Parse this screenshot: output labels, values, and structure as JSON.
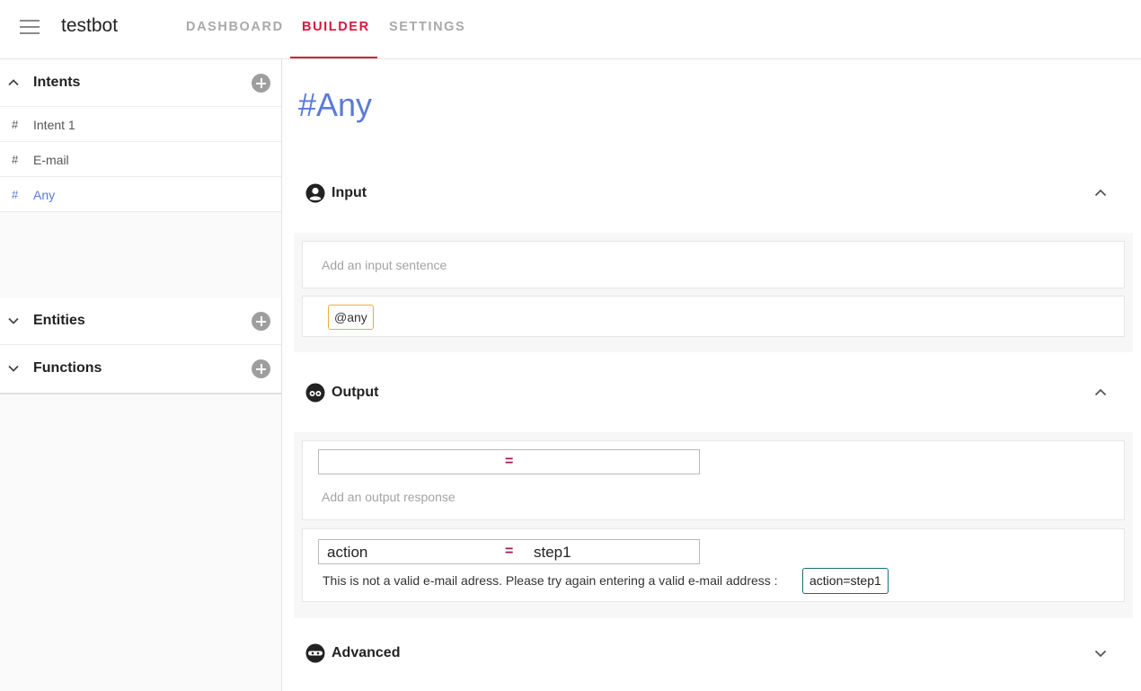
{
  "app": {
    "title": "testbot"
  },
  "tabs": [
    {
      "label": "DASHBOARD",
      "active": false
    },
    {
      "label": "BUILDER",
      "active": true
    },
    {
      "label": "SETTINGS",
      "active": false
    }
  ],
  "colors": {
    "accent": "#d6173d",
    "link": "#5a7bd5",
    "chip_any_border": "#e8b23a",
    "chip_action_border": "#1e6b7a"
  },
  "sidebar": {
    "intents": {
      "title": "Intents",
      "expanded": true,
      "items": [
        {
          "label": "Intent 1",
          "prefix": "#",
          "active": false
        },
        {
          "label": "E-mail",
          "prefix": "#",
          "active": false
        },
        {
          "label": "Any",
          "prefix": "#",
          "active": true
        }
      ]
    },
    "entities": {
      "title": "Entities",
      "expanded": false
    },
    "functions": {
      "title": "Functions",
      "expanded": false
    }
  },
  "main": {
    "intent_title": "#Any",
    "input": {
      "title": "Input",
      "icon": "user-circle-icon",
      "placeholder": "Add an input sentence",
      "chip": "@any"
    },
    "output": {
      "title": "Output",
      "icon": "output-bot-icon",
      "new_entry": {
        "key": "",
        "equals": "=",
        "value": ""
      },
      "placeholder": "Add an output response",
      "entry": {
        "key": "action",
        "equals": "=",
        "value": "step1",
        "response": "This is not a valid e-mail adress. Please try again entering a valid e-mail address :",
        "chip": "action=step1"
      }
    },
    "advanced": {
      "title": "Advanced",
      "icon": "ninja-icon"
    }
  }
}
